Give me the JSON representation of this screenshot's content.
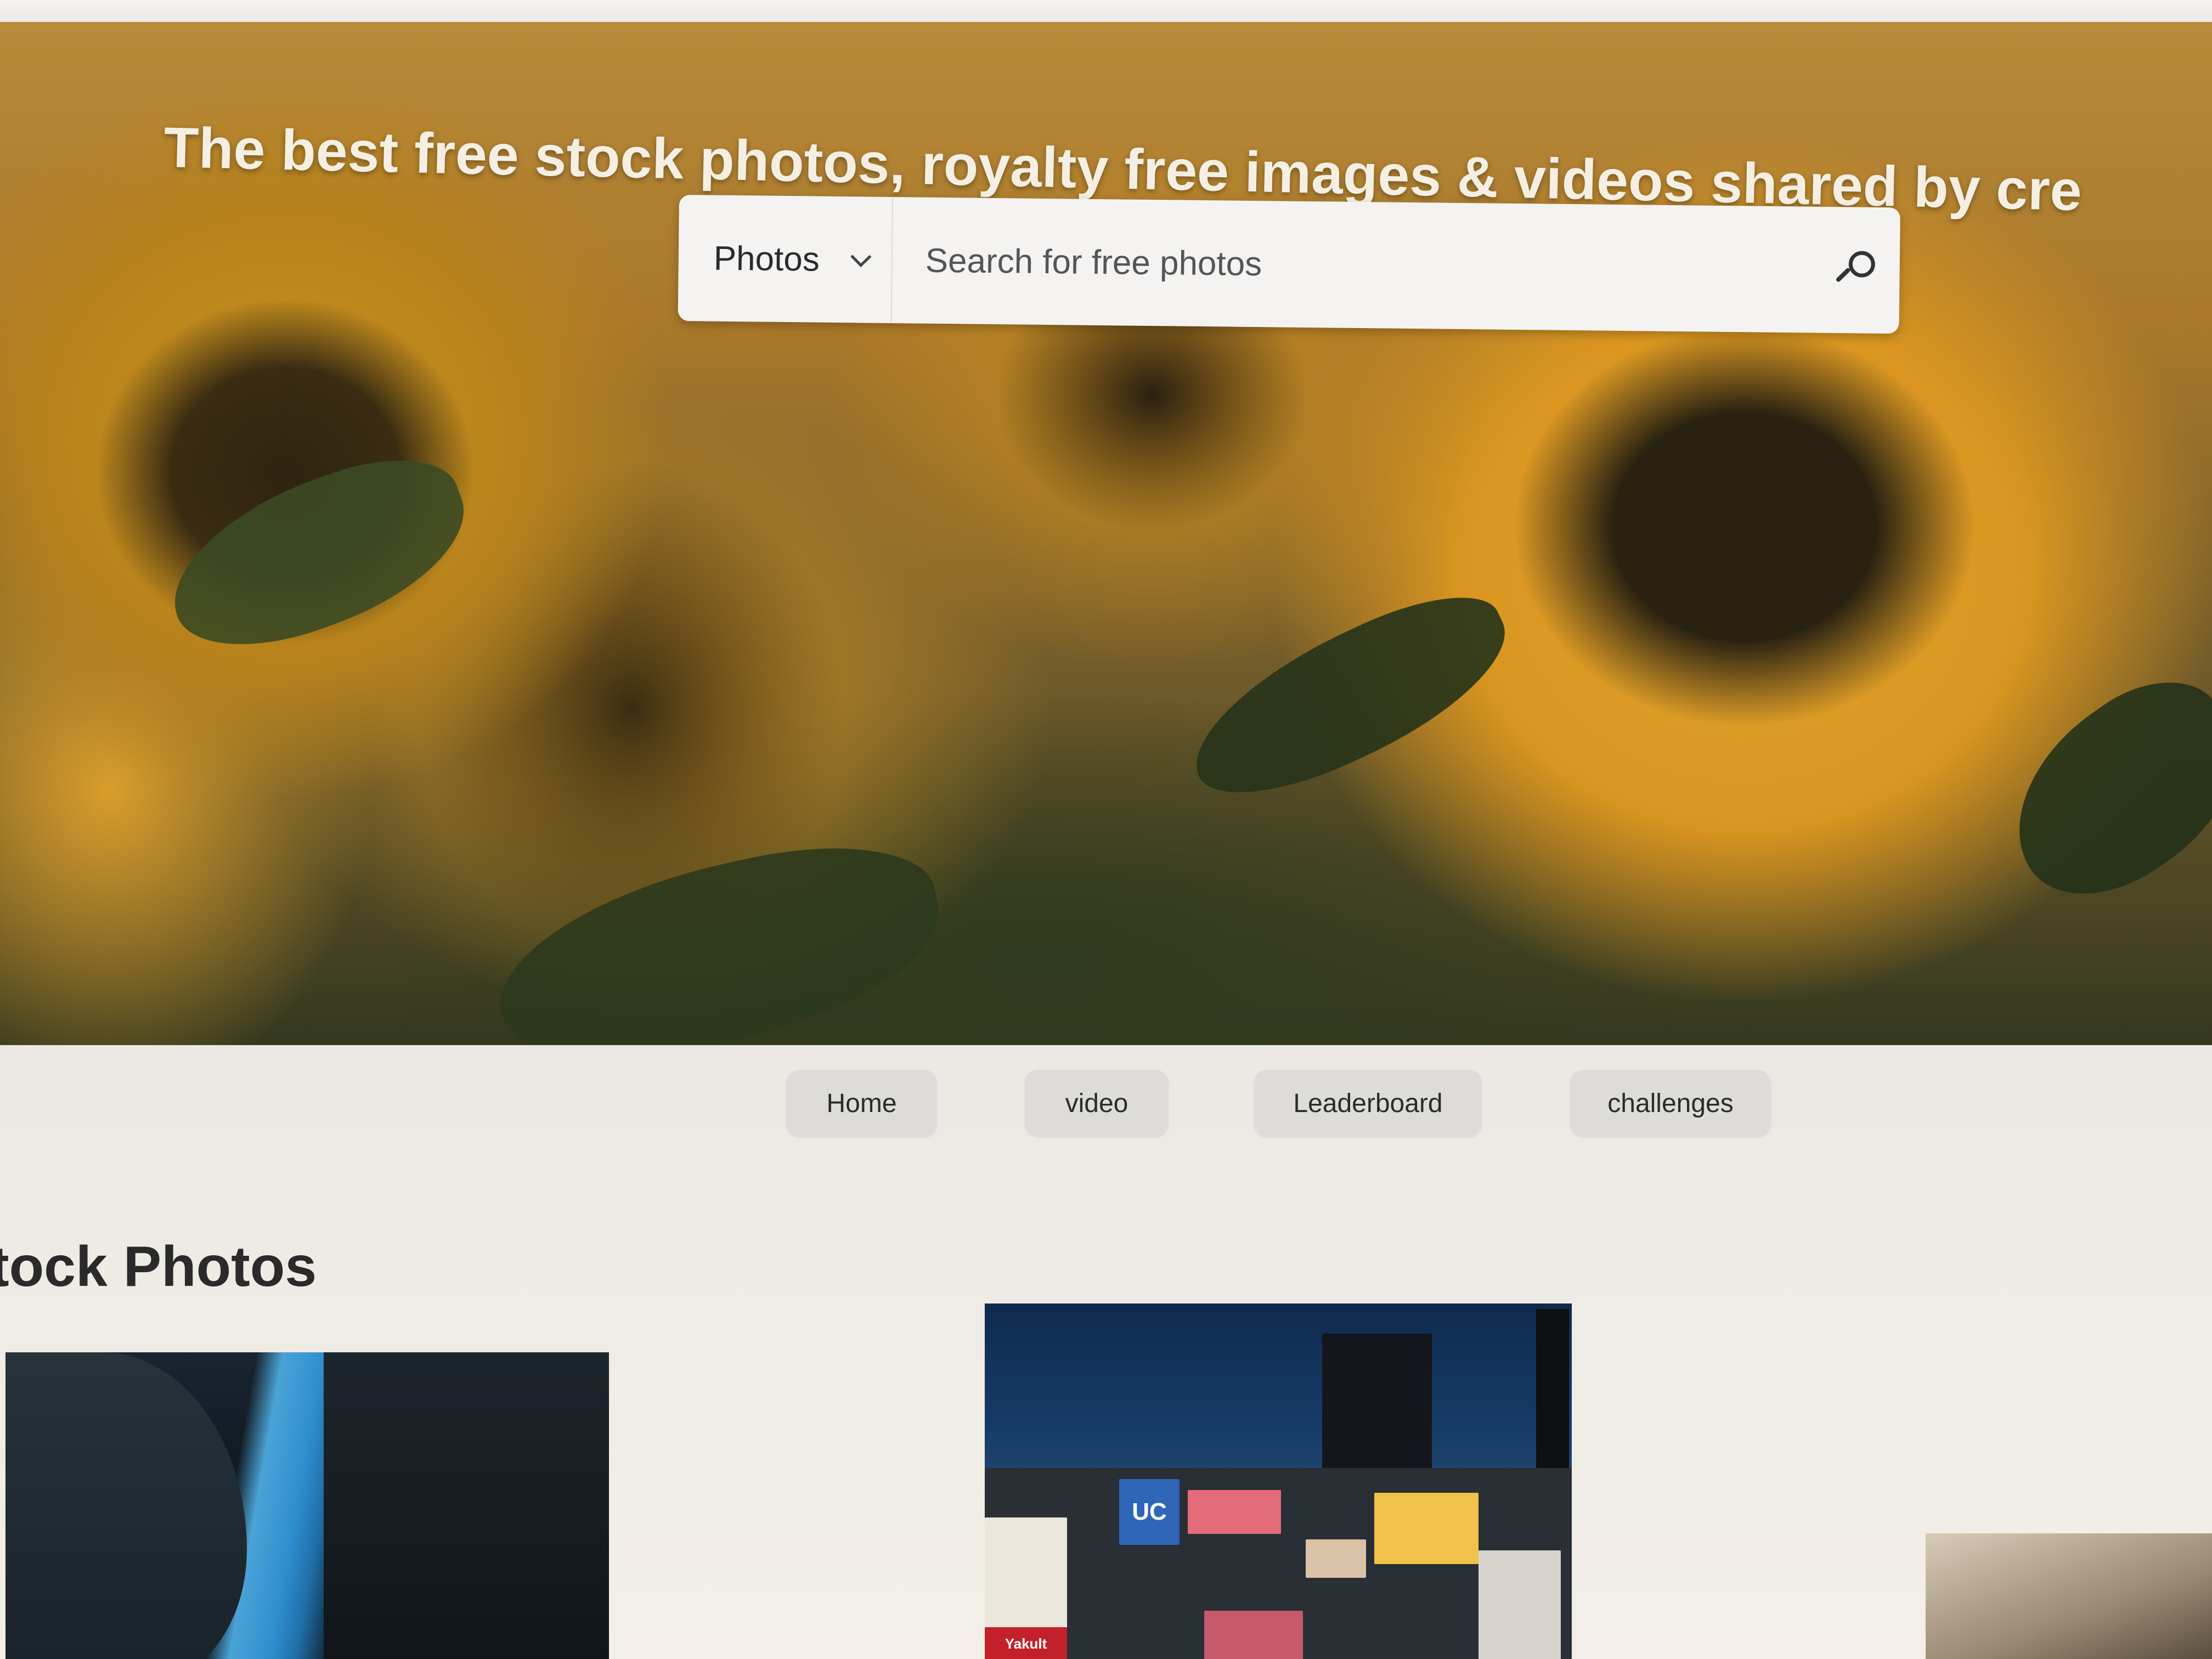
{
  "hero": {
    "title": "The best free stock photos, royalty free images & videos shared by cre"
  },
  "search": {
    "type_label": "Photos",
    "placeholder": "Search for free photos",
    "icon": "search-icon"
  },
  "nav": {
    "items": [
      {
        "label": "Home"
      },
      {
        "label": "video"
      },
      {
        "label": "Leaderboard"
      },
      {
        "label": "challenges"
      }
    ]
  },
  "section": {
    "title": "tock Photos"
  },
  "photos": {
    "city_signs": [
      "UC",
      "Yakult"
    ]
  }
}
